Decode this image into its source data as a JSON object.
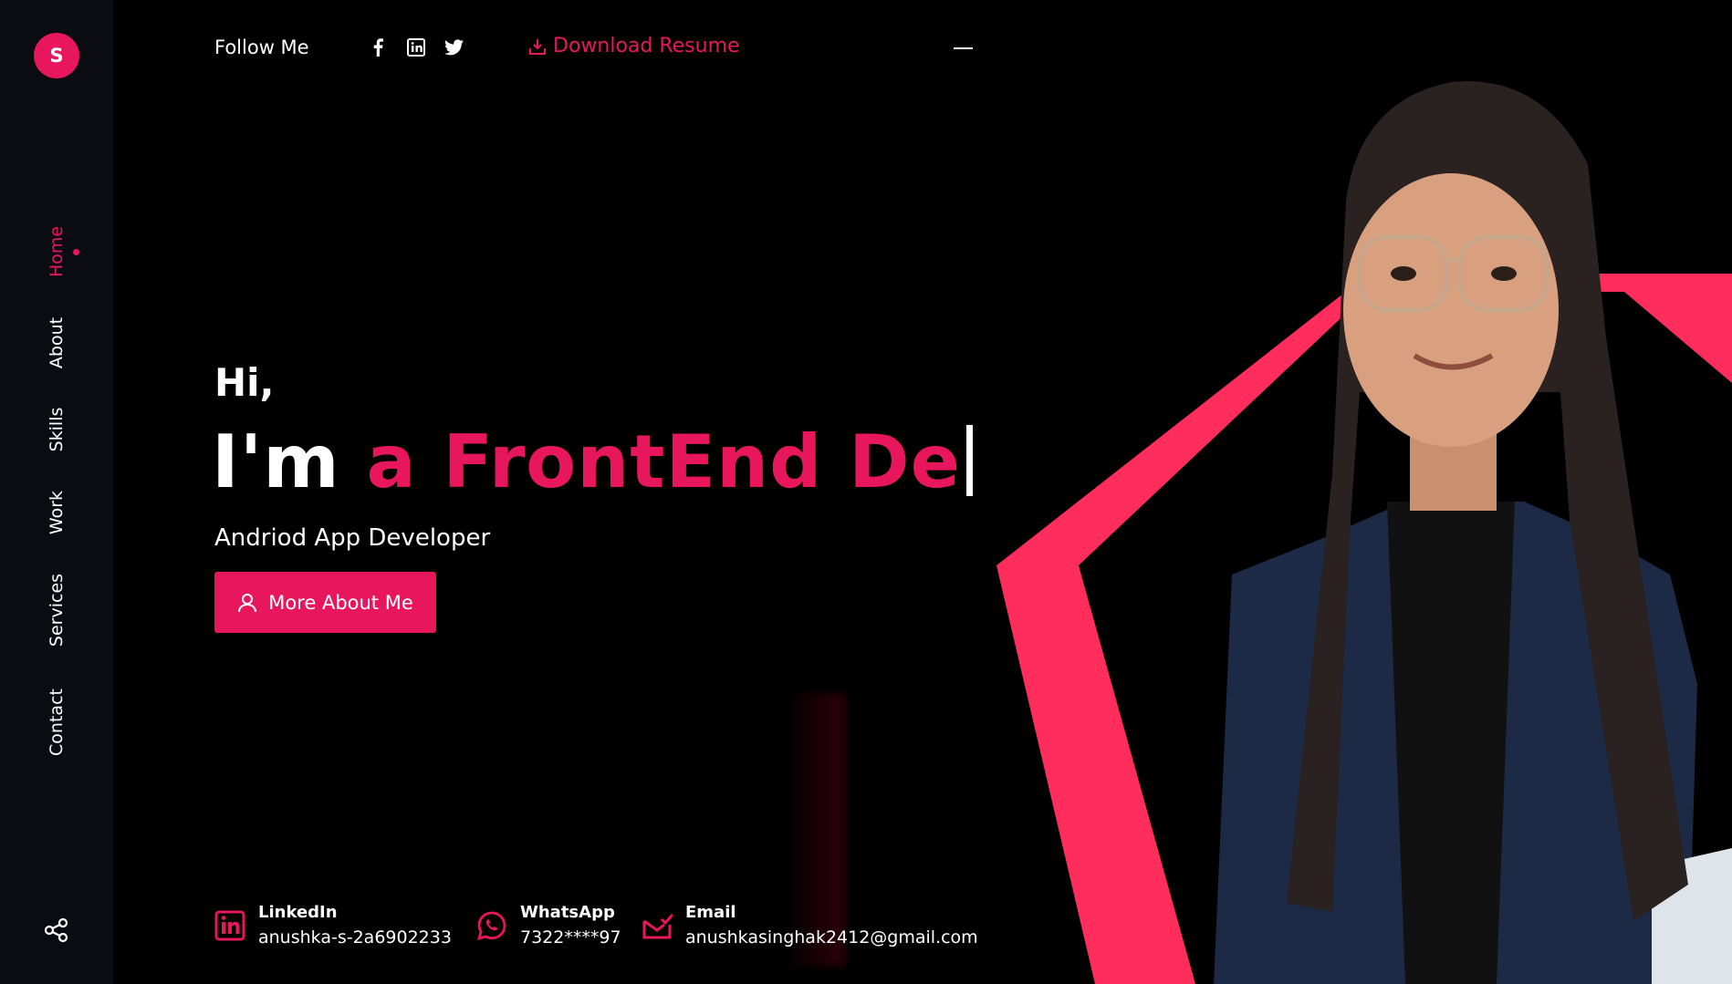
{
  "brand": {
    "logo_letter": "S"
  },
  "colors": {
    "accent": "#e8175d",
    "hexagon": "#ff2d5c",
    "background": "#000000",
    "sidebar": "#0b0b12"
  },
  "sidebar": {
    "items": [
      {
        "label": "Home",
        "active": true
      },
      {
        "label": "About",
        "active": false
      },
      {
        "label": "Skills",
        "active": false
      },
      {
        "label": "Work",
        "active": false
      },
      {
        "label": "Services",
        "active": false
      },
      {
        "label": "Contact",
        "active": false
      }
    ],
    "share_icon": "share-icon"
  },
  "topbar": {
    "follow_label": "Follow Me",
    "social_icons": [
      "facebook-icon",
      "linkedin-icon",
      "twitter-icon"
    ],
    "download_label": "Download Resume"
  },
  "hero": {
    "greeting": "Hi,",
    "headline_prefix": "I'm",
    "headline_typed": "a FrontEnd De",
    "subtitle": "Andriod App Developer",
    "cta_label": "More About Me"
  },
  "contacts": [
    {
      "label": "LinkedIn",
      "value": "anushka-s-2a6902233",
      "icon": "linkedin-icon"
    },
    {
      "label": "WhatsApp",
      "value": "7322****97",
      "icon": "whatsapp-icon"
    },
    {
      "label": "Email",
      "value": "anushkasinghak2412@gmail.com",
      "icon": "email-icon"
    }
  ]
}
